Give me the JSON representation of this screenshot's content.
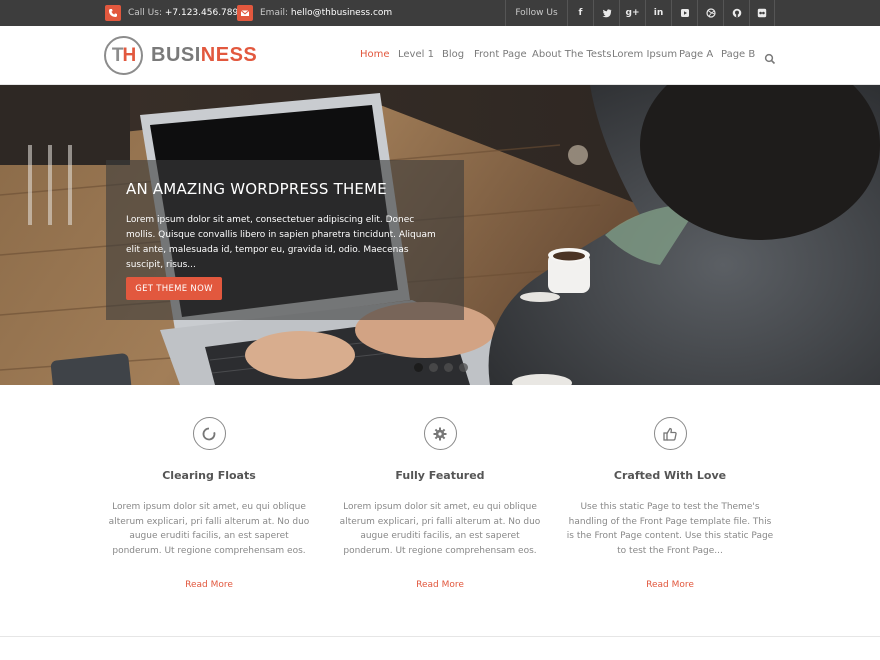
{
  "topbar": {
    "phone_label": "Call Us: ",
    "phone": "+7.123.456.789",
    "email_label": "Email: ",
    "email": "hello@thbusiness.com",
    "follow_label": "Follow Us",
    "social_icons": [
      "facebook-icon",
      "twitter-icon",
      "google-plus-icon",
      "linkedin-icon",
      "youtube-icon",
      "dribbble-icon",
      "github-icon",
      "flickr-icon"
    ]
  },
  "logo": {
    "mark_t": "T",
    "mark_h": "H",
    "word_a": "BUSI",
    "word_b": "NESS"
  },
  "nav": {
    "items": [
      "Home",
      "Level 1",
      "Blog",
      "Front Page",
      "About The Tests",
      "Lorem Ipsum",
      "Page A",
      "Page B"
    ],
    "active_index": 0,
    "search_icon": "search-icon"
  },
  "hero": {
    "title": "AN AMAZING WORDPRESS THEME",
    "text": "Lorem ipsum dolor sit amet, consectetuer adipiscing elit. Donec mollis. Quisque convallis libero in sapien pharetra tincidunt. Aliquam elit ante, malesuada id, tempor eu, gravida id, odio. Maecenas suscipit, risus...",
    "button": "GET THEME NOW",
    "slide_count": 4,
    "active_slide": 0
  },
  "features": [
    {
      "icon": "spinner-icon",
      "title": "Clearing Floats",
      "text": "Lorem ipsum dolor sit amet, eu qui oblique alterum explicari, pri falli alterum at. No duo augue eruditi facilis, an est saperet ponderum. Ut regione comprehensam eos.",
      "link": "Read More"
    },
    {
      "icon": "gear-icon",
      "title": "Fully Featured",
      "text": "Lorem ipsum dolor sit amet, eu qui oblique alterum explicari, pri falli alterum at. No duo augue eruditi facilis, an est saperet ponderum. Ut regione comprehensam eos.",
      "link": "Read More"
    },
    {
      "icon": "thumbs-up-icon",
      "title": "Crafted With Love",
      "text": "Use this static Page to test the Theme's handling of the Front Page template file. This is the Front Page content. Use this static Page to test the Front Page...",
      "link": "Read More"
    }
  ],
  "colors": {
    "accent": "#e2583e",
    "topbar": "#3d3d3d",
    "text": "#666666"
  }
}
